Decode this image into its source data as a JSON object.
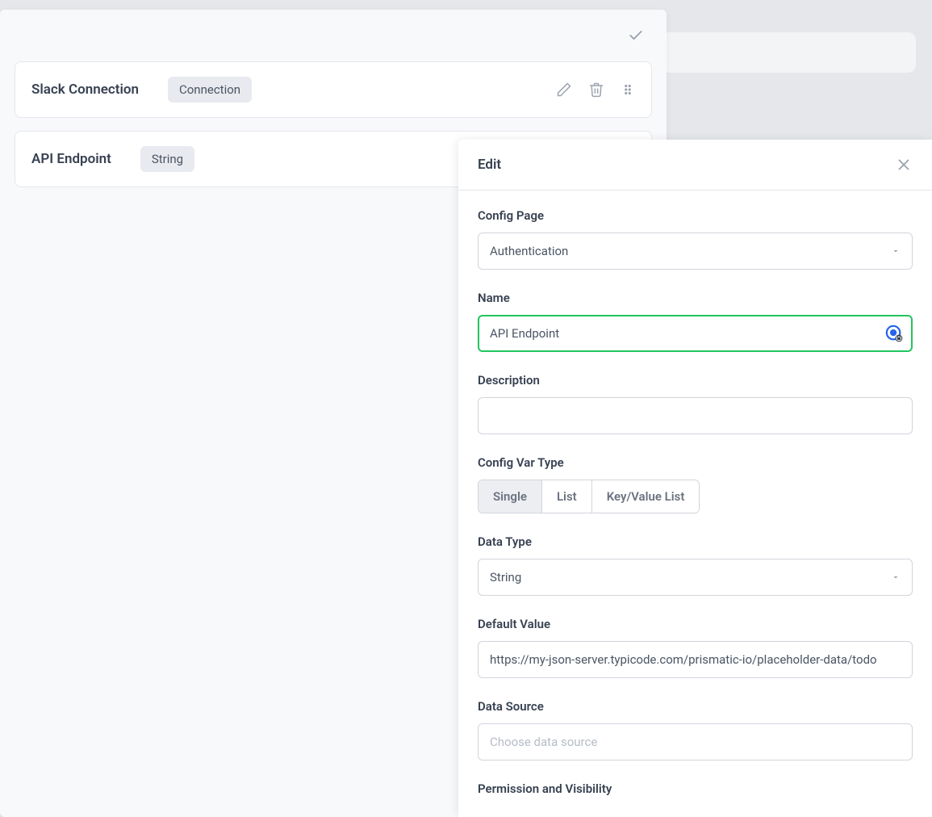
{
  "configList": {
    "items": [
      {
        "title": "Slack Connection",
        "typeChip": "Connection"
      },
      {
        "title": "API Endpoint",
        "typeChip": "String"
      }
    ]
  },
  "editPanel": {
    "heading": "Edit",
    "fields": {
      "configPage": {
        "label": "Config Page",
        "value": "Authentication"
      },
      "name": {
        "label": "Name",
        "value": "API Endpoint"
      },
      "description": {
        "label": "Description",
        "value": ""
      },
      "configVarType": {
        "label": "Config Var Type",
        "options": [
          "Single",
          "List",
          "Key/Value List"
        ],
        "selected": "Single"
      },
      "dataType": {
        "label": "Data Type",
        "value": "String"
      },
      "defaultValue": {
        "label": "Default Value",
        "value": "https://my-json-server.typicode.com/prismatic-io/placeholder-data/todo"
      },
      "dataSource": {
        "label": "Data Source",
        "placeholder": "Choose data source",
        "value": ""
      },
      "permission": {
        "label": "Permission and Visibility"
      }
    }
  }
}
